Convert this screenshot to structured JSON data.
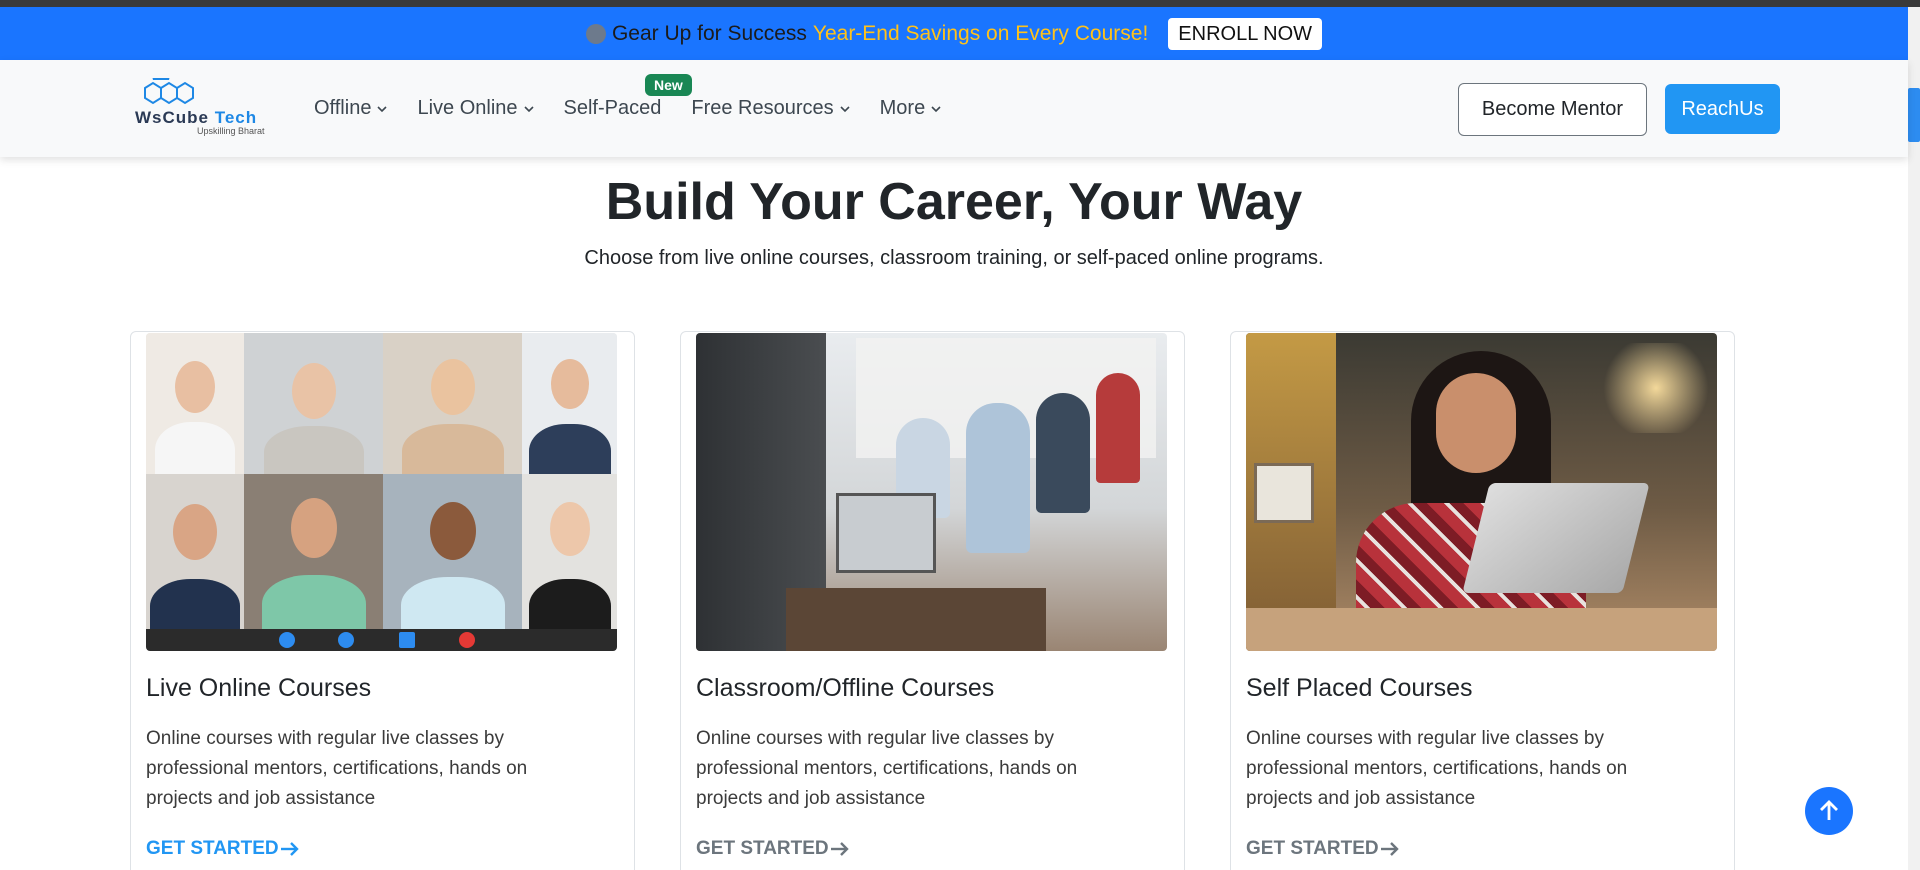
{
  "announcement": {
    "lead": "Gear Up for Success",
    "promo": "Year-End Savings on Every Course!",
    "cta": "ENROLL NOW"
  },
  "brand": {
    "word_a": "WsCube",
    "word_b": "Tech",
    "tagline": "Upskilling Bharat"
  },
  "nav": {
    "items": [
      {
        "label": "Offline",
        "dropdown": true
      },
      {
        "label": "Live Online",
        "dropdown": true
      },
      {
        "label": "Self-Paced",
        "dropdown": false
      },
      {
        "label": "Free Resources",
        "dropdown": true
      },
      {
        "label": "More",
        "dropdown": true
      }
    ],
    "new_badge": "New",
    "mentor_button": "Become Mentor",
    "reach_button": "ReachUs"
  },
  "hero": {
    "title": "Build Your Career, Your Way",
    "subtitle": "Choose from live online courses, classroom training, or self-paced online programs."
  },
  "cards": [
    {
      "title": "Live Online Courses",
      "description": "Online courses with regular live classes by professional mentors, certifications, hands on projects and job assistance",
      "cta": "GET STARTED",
      "image": "video-call-grid-photo"
    },
    {
      "title": "Classroom/Offline Courses",
      "description": "Online courses with regular live classes by professional mentors, certifications, hands on projects and job assistance",
      "cta": "GET STARTED",
      "image": "classroom-photo"
    },
    {
      "title": "Self Placed Courses",
      "description": "Online courses with regular live classes by professional mentors, certifications, hands on projects and job assistance",
      "cta": "GET STARTED",
      "image": "woman-laptop-photo"
    }
  ],
  "colors": {
    "accent": "#1a75ff",
    "promo": "#ffc21a",
    "new_badge": "#198754",
    "reach_button": "#2196f3"
  },
  "icons": {
    "chevron": "chevron-down-icon",
    "arrow": "arrow-right-icon",
    "scroll_top": "arrow-up-icon"
  }
}
